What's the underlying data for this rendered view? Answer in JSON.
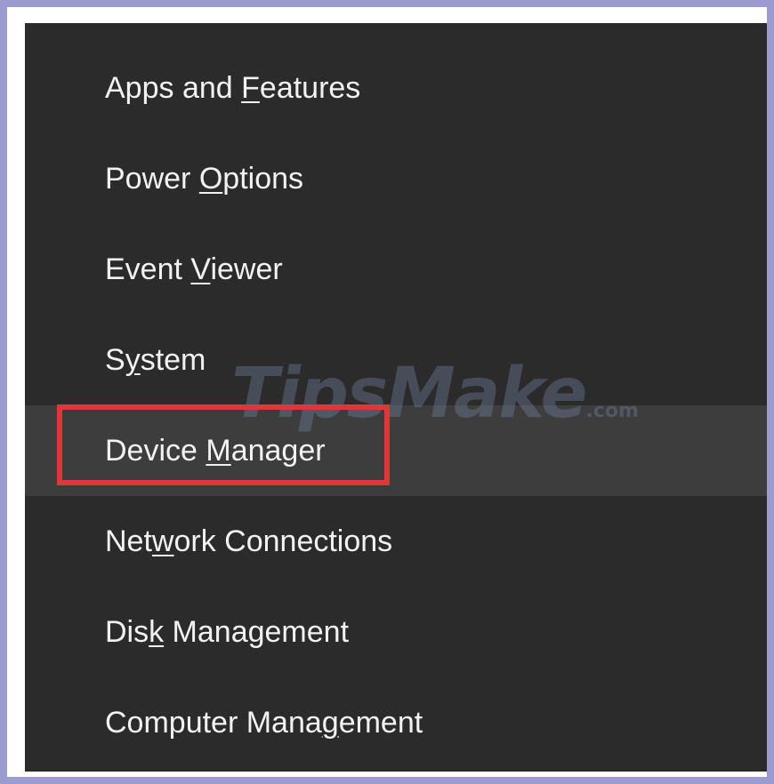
{
  "menu": {
    "items": [
      {
        "pre": "Apps and ",
        "mnemonic": "F",
        "post": "eatures"
      },
      {
        "pre": "Power ",
        "mnemonic": "O",
        "post": "ptions"
      },
      {
        "pre": "Event ",
        "mnemonic": "V",
        "post": "iewer"
      },
      {
        "pre": "S",
        "mnemonic": "y",
        "post": "stem"
      },
      {
        "pre": "Device ",
        "mnemonic": "M",
        "post": "anager"
      },
      {
        "pre": "Net",
        "mnemonic": "w",
        "post": "ork Connections"
      },
      {
        "pre": "Dis",
        "mnemonic": "k",
        "post": " Management"
      },
      {
        "pre": "Computer Mana",
        "mnemonic": "g",
        "post": "ement"
      }
    ],
    "hovered_item": "Device Manager"
  },
  "watermark": {
    "text": "TipsMake",
    "suffix": ".com"
  },
  "colors": {
    "frame": "#9b9bd2",
    "menu_bg": "#2b2b2b",
    "hover_bg": "#3d3d3d",
    "text": "#f2f2f2",
    "highlight": "#e0353b"
  }
}
